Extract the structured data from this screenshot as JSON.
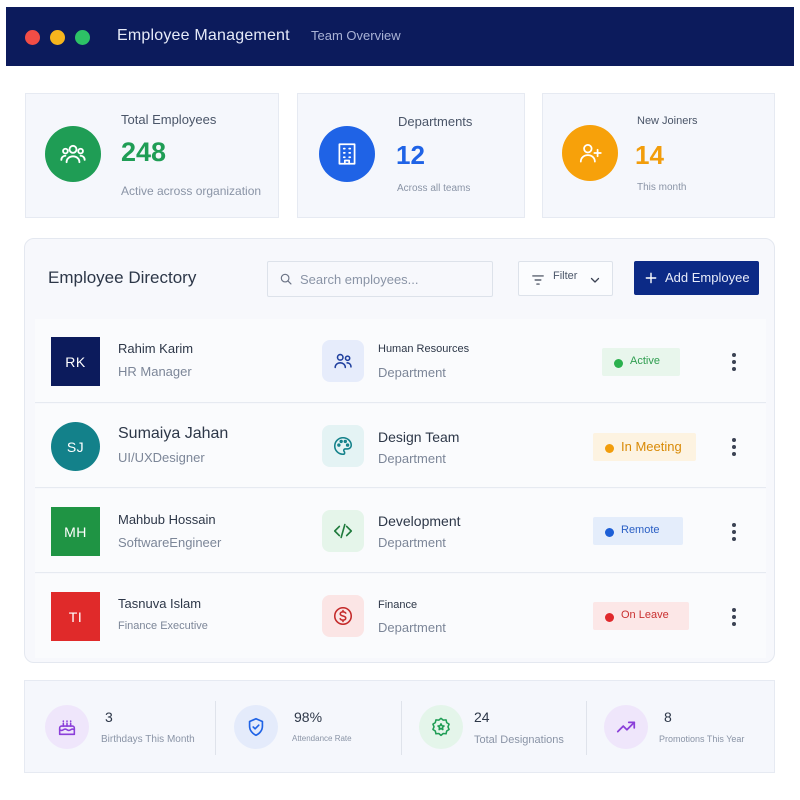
{
  "window": {
    "title": "Employee Management",
    "subtitle": "Team Overview",
    "controls": [
      "close",
      "minimize",
      "maximize"
    ]
  },
  "stats": [
    {
      "label": "Total Employees",
      "value": "248",
      "note": "Active across organization",
      "icon": "users-icon",
      "color": "#1f9d55"
    },
    {
      "label": "Departments",
      "value": "12",
      "note": "Across all teams",
      "icon": "building-icon",
      "color": "#1f63e6"
    },
    {
      "label": "New Joiners",
      "value": "14",
      "note": "This month",
      "icon": "user-plus-icon",
      "color": "#f7a10a"
    }
  ],
  "directory": {
    "title": "Employee Directory",
    "search_placeholder": "Search employees...",
    "filter_label": "Filter",
    "add_label": "Add Employee",
    "employees": [
      {
        "initials": "RK",
        "name": "Rahim Karim",
        "role": "HR Manager",
        "department": "Human Resources",
        "dept_sub": "Department",
        "status": "Active",
        "avatar_color": "#0c1b5c",
        "dept_icon": "users-icon",
        "status_color": "#2bb14e"
      },
      {
        "initials": "SJ",
        "name": "Sumaiya Jahan",
        "role": "UI/UXDesigner",
        "department": "Design Team",
        "dept_sub": "Department",
        "status": "In Meeting",
        "avatar_color": "#13818a",
        "dept_icon": "palette-icon",
        "status_color": "#f29d0b"
      },
      {
        "initials": "MH",
        "name": "Mahbub Hossain",
        "role": "SoftwareEngineer",
        "department": "Development",
        "dept_sub": "Department",
        "status": "Remote",
        "avatar_color": "#1f9444",
        "dept_icon": "code-icon",
        "status_color": "#1d5fd6"
      },
      {
        "initials": "TI",
        "name": "Tasnuva Islam",
        "role": "Finance Executive",
        "department": "Finance",
        "dept_sub": "Department",
        "status": "On Leave",
        "avatar_color": "#e02a2a",
        "dept_icon": "dollar-icon",
        "status_color": "#e0292c"
      }
    ]
  },
  "summary": [
    {
      "value": "3",
      "label": "Birthdays This Month",
      "icon": "cake-icon",
      "color": "#8b3fd9"
    },
    {
      "value": "98%",
      "label": "Attendance Rate",
      "icon": "shield-check-icon",
      "color": "#1f63e6"
    },
    {
      "value": "24",
      "label": "Total Designations",
      "icon": "award-icon",
      "color": "#1f9d55"
    },
    {
      "value": "8",
      "label": "Promotions This Year",
      "icon": "trending-up-icon",
      "color": "#8b3fd9"
    }
  ]
}
